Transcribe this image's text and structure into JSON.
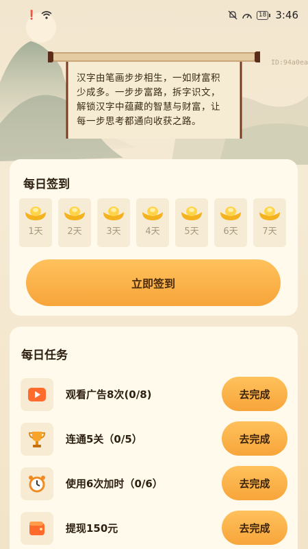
{
  "status_bar": {
    "time": "3:46",
    "battery": "18"
  },
  "banner": {
    "id_tag": "ID:94a0ea",
    "scroll_lines": [
      "汉字由笔画步步相生，一如财富积",
      "少成多。一步步富路，拆字识文，",
      "解锁汉字中蕴藏的智慧与财富，让",
      "每一步思考都通向收获之路。"
    ]
  },
  "signin": {
    "title": "每日签到",
    "days": [
      "1天",
      "2天",
      "3天",
      "4天",
      "5天",
      "6天",
      "7天"
    ],
    "button_label": "立即签到"
  },
  "tasks": {
    "title": "每日任务",
    "items": [
      {
        "icon": "video-play-icon",
        "label": "观看广告8次(0/8)",
        "button": "去完成"
      },
      {
        "icon": "trophy-icon",
        "label": "连通5关（0/5）",
        "button": "去完成"
      },
      {
        "icon": "alarm-clock-icon",
        "label": "使用6次加时（0/6）",
        "button": "去完成"
      },
      {
        "icon": "wallet-icon",
        "label": "提现150元",
        "button": "去完成"
      }
    ]
  },
  "colors": {
    "accent": "#f7a53a",
    "card": "#fffaeb",
    "background": "#f6ecd6"
  }
}
